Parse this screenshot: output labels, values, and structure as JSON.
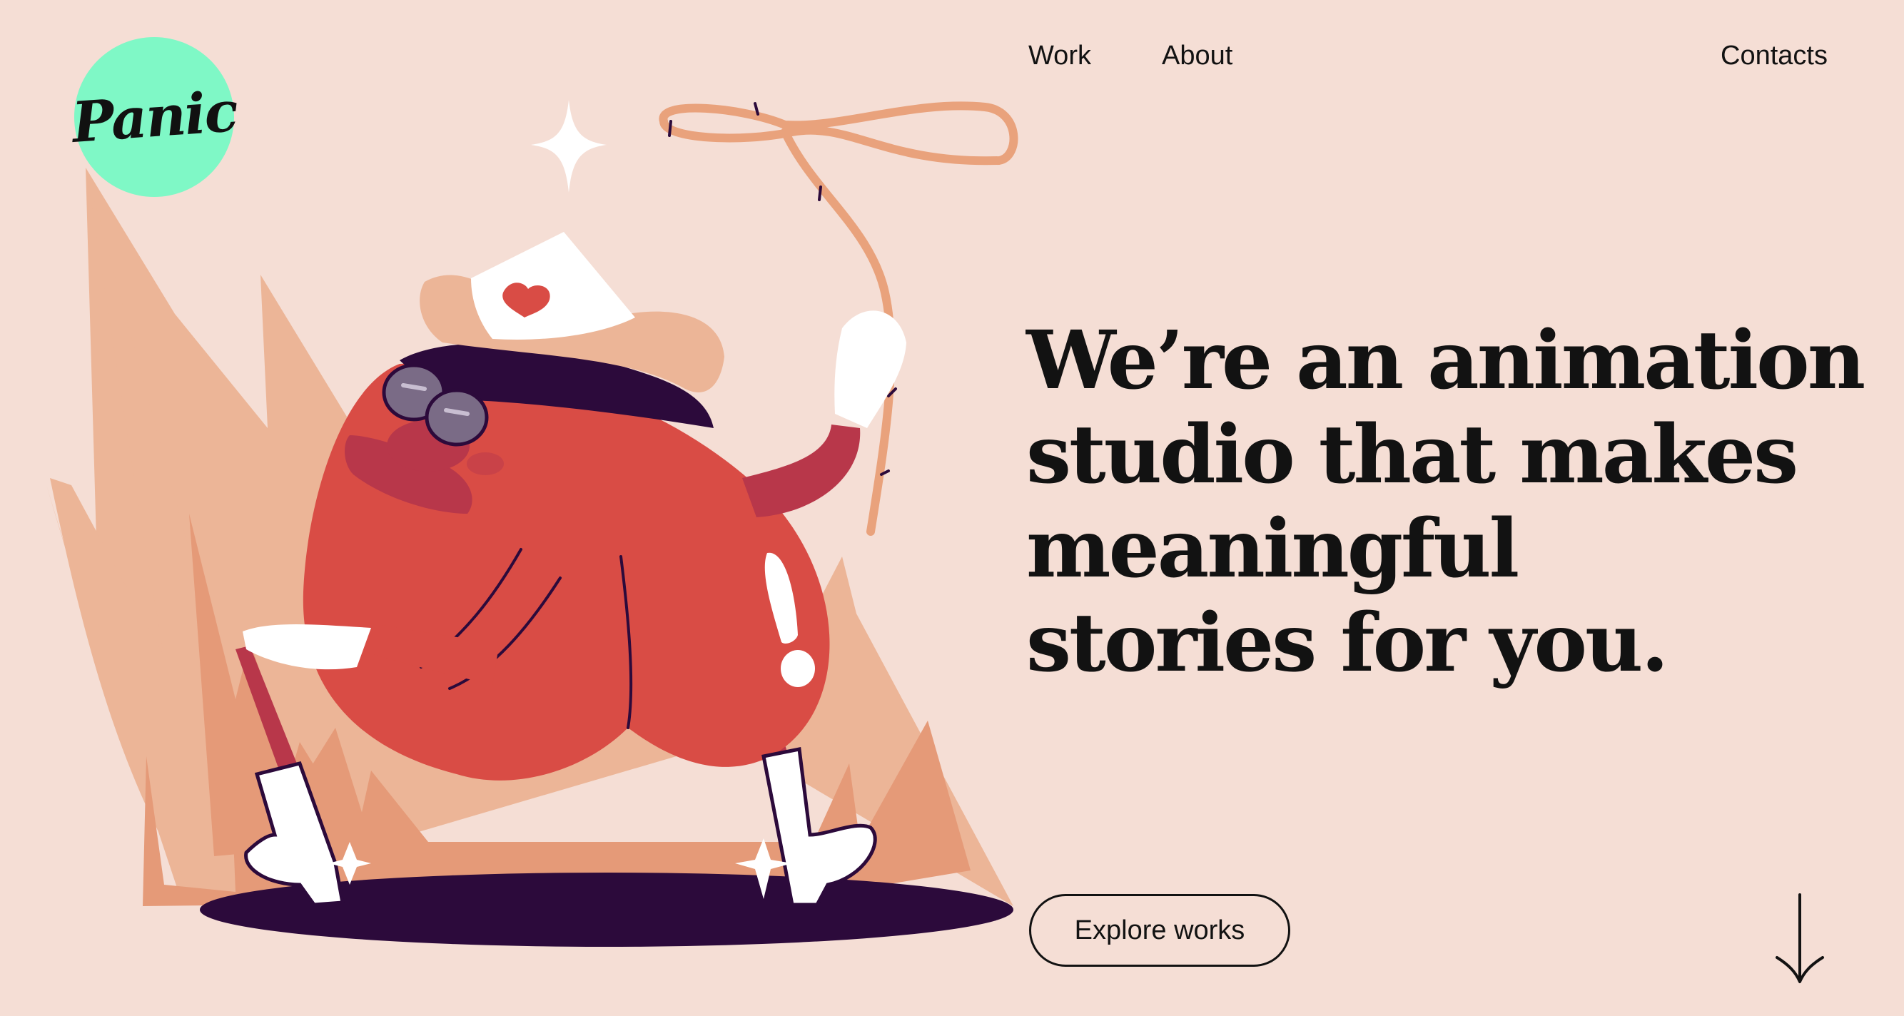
{
  "brand": {
    "logo_text": "Panic",
    "logo_color": "#7ff8c6"
  },
  "nav": {
    "items": [
      {
        "label": "Work"
      },
      {
        "label": "About"
      }
    ],
    "contacts_label": "Contacts"
  },
  "hero": {
    "headline_lines": [
      "We’re an animation",
      "studio that makes",
      "meaningful",
      "stories for you."
    ],
    "cta_label": "Explore works",
    "illustration": "cowboy-character-with-lasso",
    "scroll_icon": "arrow-down-icon"
  },
  "colors": {
    "background": "#f5ded5",
    "text": "#121212",
    "character_body": "#d94c45",
    "flames_light": "#ecb597",
    "flames_dark": "#e59a78",
    "shadow": "#2c0a3b",
    "lasso": "#e9a27c"
  }
}
